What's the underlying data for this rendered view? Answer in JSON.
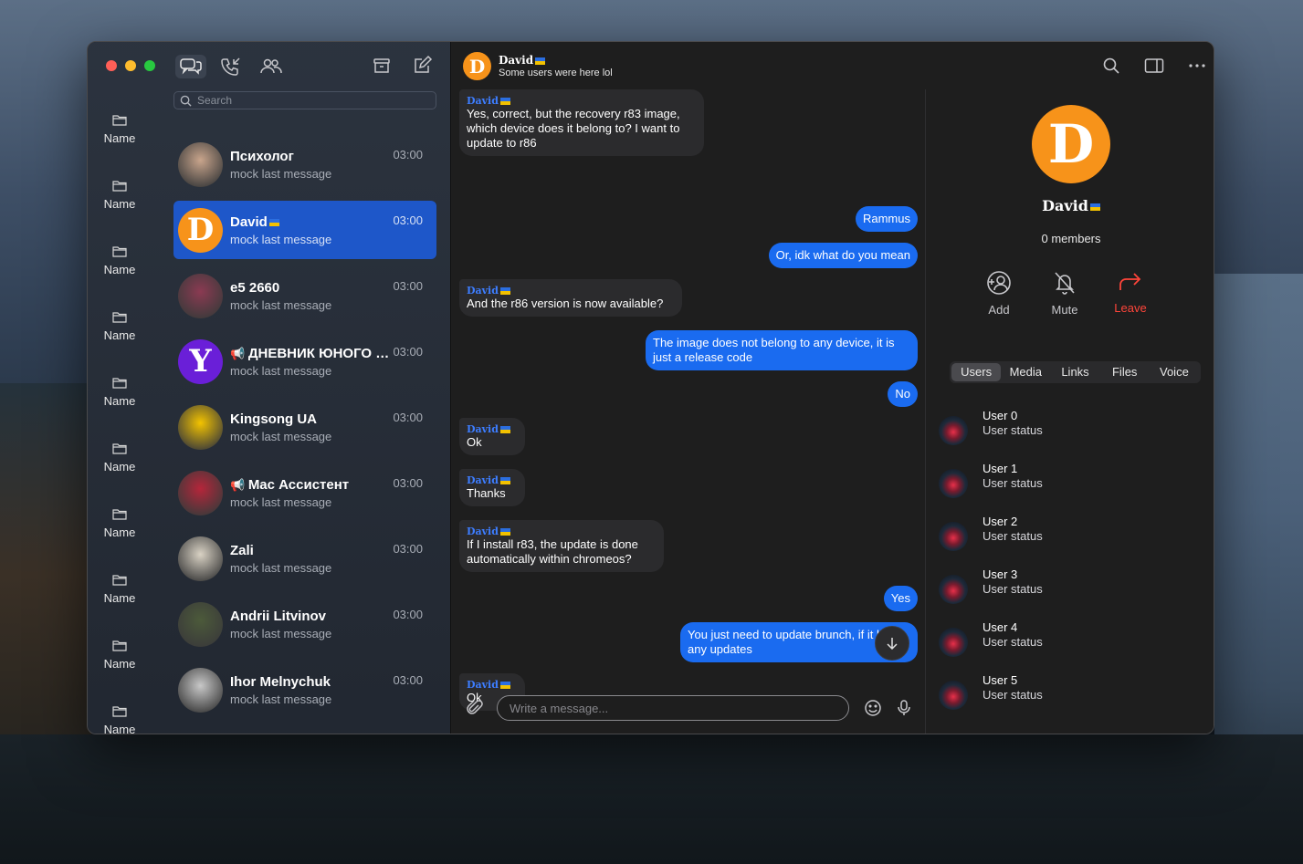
{
  "window": {
    "traffic_lights": [
      "close",
      "minimize",
      "zoom"
    ]
  },
  "toolbar": {
    "icons": [
      "chats-icon",
      "calls-icon",
      "contacts-icon",
      "archive-icon",
      "compose-icon"
    ]
  },
  "search": {
    "placeholder": "Search"
  },
  "folders": [
    {
      "label": "Name",
      "icon": "folder-icon"
    },
    {
      "label": "Name",
      "icon": "folder-icon"
    },
    {
      "label": "Name",
      "icon": "folder-icon"
    },
    {
      "label": "Name",
      "icon": "folder-icon"
    },
    {
      "label": "Name",
      "icon": "folder-icon"
    },
    {
      "label": "Name",
      "icon": "folder-icon"
    },
    {
      "label": "Name",
      "icon": "folder-icon"
    },
    {
      "label": "Name",
      "icon": "folder-icon"
    },
    {
      "label": "Name",
      "icon": "folder-icon"
    },
    {
      "label": "Name",
      "icon": "folder-icon"
    }
  ],
  "chats": [
    {
      "name": "Психолог",
      "message": "mock last message",
      "time": "03:00",
      "avatar": "photo",
      "color": "#c9a58c"
    },
    {
      "name": "David",
      "message": "mock last message",
      "time": "03:00",
      "avatar": "D",
      "color": "#f7931a",
      "selected": true
    },
    {
      "name": "e5 2660",
      "message": "mock last message",
      "time": "03:00",
      "avatar": "photo",
      "color": "#8b3a52"
    },
    {
      "name": "ДНЕВНИК ЮНОГО ТРЕЙДЕРА",
      "message": "mock last message",
      "time": "03:00",
      "avatar": "Y",
      "color": "#6a1fd8",
      "channel": true
    },
    {
      "name": "Kingsong UA",
      "message": "mock last message",
      "time": "03:00",
      "avatar": "photo",
      "color": "#f3c300"
    },
    {
      "name": "Mac Ассистент",
      "message": "mock last message",
      "time": "03:00",
      "avatar": "photo",
      "color": "#b5263a",
      "channel": true
    },
    {
      "name": "Zali",
      "message": "mock last message",
      "time": "03:00",
      "avatar": "photo",
      "color": "#d9d2c4"
    },
    {
      "name": "Andrii Litvinov",
      "message": "mock last message",
      "time": "03:00",
      "avatar": "photo",
      "color": "#4c5a3a"
    },
    {
      "name": "Ihor Melnychuk",
      "message": "mock last message",
      "time": "03:00",
      "avatar": "photo",
      "color": "#c8c8c8"
    }
  ],
  "conversation": {
    "name": "David",
    "subtitle": "Some users were here lol",
    "avatar_letter": "D",
    "messages": [
      {
        "dir": "in",
        "sender": "David",
        "text": "Yes, correct, but the recovery r83 image, which device does it belong to? I want to update to r86"
      },
      {
        "dir": "out",
        "text": "Rammus"
      },
      {
        "dir": "out",
        "text": "Or, idk what do you mean"
      },
      {
        "dir": "in",
        "sender": "David",
        "text": "And the r86 version is now available?"
      },
      {
        "dir": "out",
        "text": "The image does not belong to any device, it is just a release code"
      },
      {
        "dir": "out",
        "text": "No"
      },
      {
        "dir": "in",
        "sender": "David",
        "text": "Ok"
      },
      {
        "dir": "in",
        "sender": "David",
        "text": "Thanks"
      },
      {
        "dir": "in",
        "sender": "David",
        "text": "If I install r83, the update is done automatically within chromeos?"
      },
      {
        "dir": "out",
        "text": "Yes"
      },
      {
        "dir": "out",
        "text": "You just need to update brunch, if it has any updates"
      },
      {
        "dir": "in",
        "sender": "David",
        "text": "Ok"
      }
    ],
    "composer_placeholder": "Write a message..."
  },
  "info": {
    "name": "David",
    "members": "0 members",
    "actions": [
      {
        "label": "Add",
        "icon": "add-user-icon"
      },
      {
        "label": "Mute",
        "icon": "bell-slash-icon"
      },
      {
        "label": "Leave",
        "icon": "leave-arrow-icon"
      }
    ],
    "tabs": [
      "Users",
      "Media",
      "Links",
      "Files",
      "Voice"
    ],
    "active_tab": "Users",
    "users": [
      {
        "name": "User 0",
        "status": "User status"
      },
      {
        "name": "User 1",
        "status": "User status"
      },
      {
        "name": "User 2",
        "status": "User status"
      },
      {
        "name": "User 3",
        "status": "User status"
      },
      {
        "name": "User 4",
        "status": "User status"
      },
      {
        "name": "User 5",
        "status": "User status"
      }
    ]
  },
  "colors": {
    "accent": "#1a6bf0",
    "selected_chat": "#1e57c9",
    "avatar_orange": "#f7931a",
    "leave_red": "#ff453a"
  }
}
